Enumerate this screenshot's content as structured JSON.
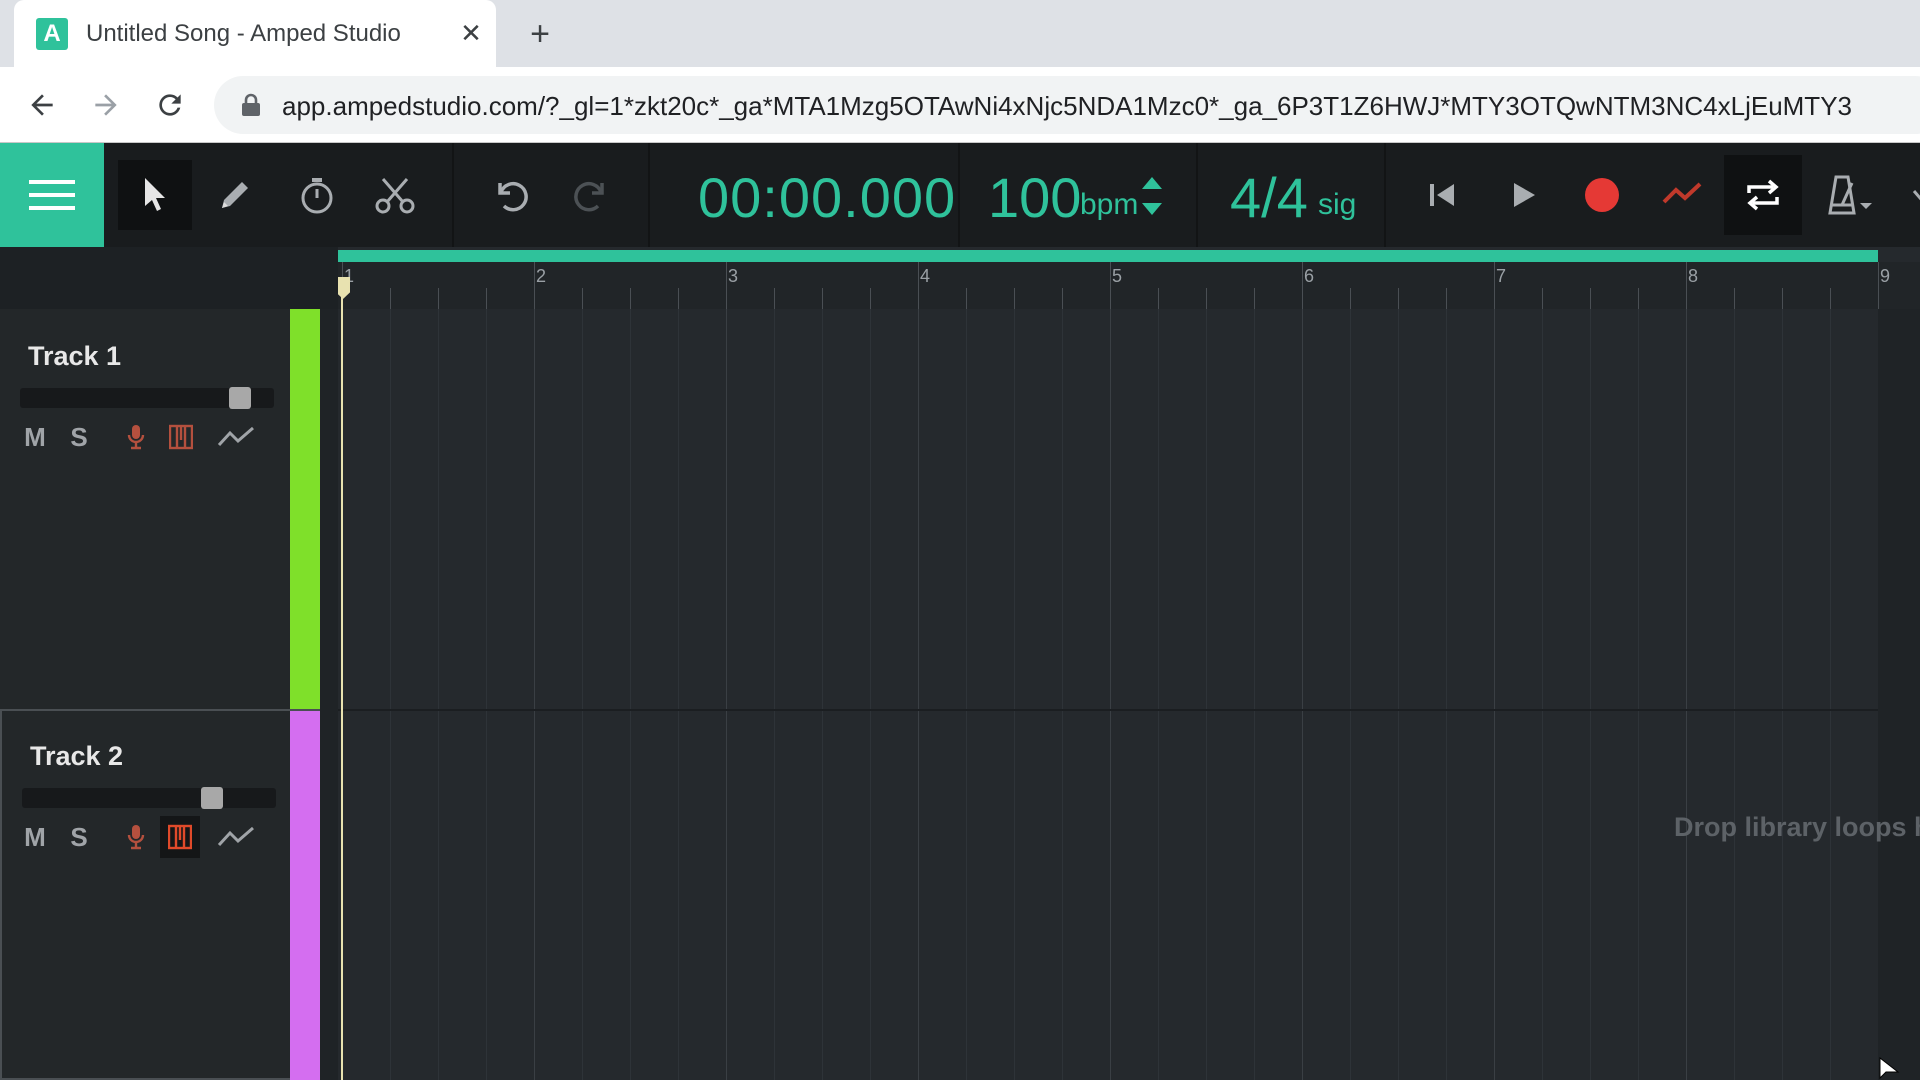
{
  "browser": {
    "tab_title": "Untitled Song - Amped Studio",
    "favicon_letter": "A",
    "close_glyph": "✕",
    "new_tab_glyph": "+",
    "url": "app.ampedstudio.com/?_gl=1*zkt20c*_ga*MTA1Mzg5OTAwNi4xNjc5NDA1Mzc0*_ga_6P3T1Z6HWJ*MTY3OTQwNTM3NC4xLjEuMTY3"
  },
  "transport": {
    "time": "00:00.000",
    "bpm_value": "100",
    "bpm_unit": "bpm",
    "sig_value": "4/4",
    "sig_unit": "sig"
  },
  "ruler": {
    "bars": [
      "1",
      "2",
      "3",
      "4",
      "5",
      "6",
      "7",
      "8",
      "9"
    ]
  },
  "tracks": [
    {
      "name": "Track 1",
      "mute": "M",
      "solo": "S",
      "color": "#7fe02a",
      "volume": 0.9
    },
    {
      "name": "Track 2",
      "mute": "M",
      "solo": "S",
      "color": "#d46ef0",
      "volume": 0.77
    }
  ],
  "timeline": {
    "drop_hint": "Drop library loops h"
  },
  "colors": {
    "accent": "#2fc29b",
    "record": "#e53935"
  }
}
